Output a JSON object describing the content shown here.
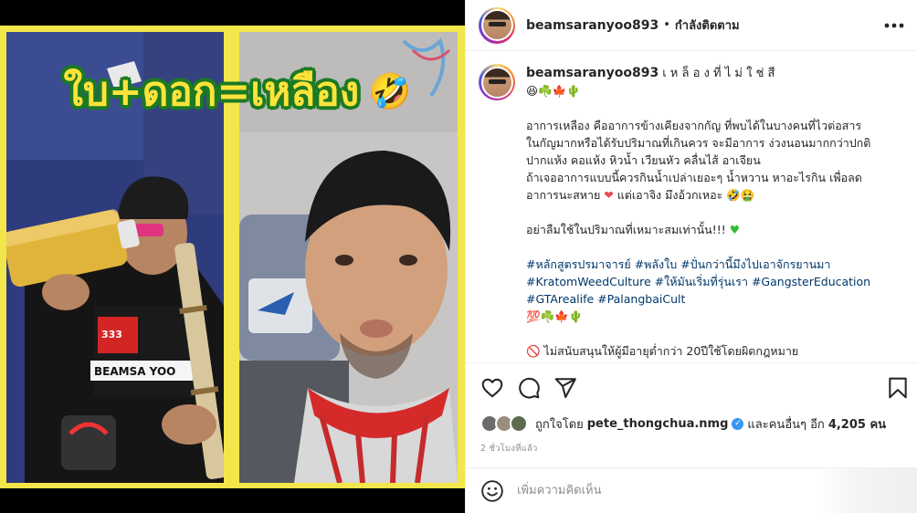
{
  "media": {
    "overlay_title": "ใบ+ดอก=เหลือง",
    "overlay_emoji": "🤣",
    "frame_color": "#f3e64a",
    "title_color": "#ffe33a",
    "title_outline_color": "#1b7a23"
  },
  "header": {
    "username": "beamsaranyoo893",
    "dot": "•",
    "following_label": "กำลังติดตาม",
    "more_icon": "more-horizontal-icon"
  },
  "caption": {
    "username": "beamsaranyoo893",
    "first_line": "เ ห ล็ อ ง ที่ ไ ม่ ใ ช่ สี",
    "emoji_line": "😆☘️🍁🌵",
    "paragraph1": [
      "อาการเหลือง คืออาการข้างเคียงจากกัญ ที่พบได้ในบางคนที่ไวต่อสาร",
      "ในกัญมากหรือได้รับปริมาณที่เกินควร จะมีอาการ ง่วงนอนมากกว่าปกติ",
      "ปากแห้ง คอแห้ง หิวน้ำ เวียนหัว คลื่นไส้ อาเจียน",
      "ถ้าเจออาการแบบนี้ควรกินน้ำเปล่าเยอะๆ น้ำหวาน หาอะไรกิน เพื่อลด"
    ],
    "paragraph1_last_prefix": "อาการนะสหาย ",
    "paragraph1_last_suffix": " แต่เอาจิง มึงอ้วกเหอะ 🤣🤮",
    "paragraph2": "อย่าลืมใช้ในปริมาณที่เหมาะสมเท่านั้น!!! ",
    "hashtags": [
      [
        "#หลักสูตรปรมาจารย์",
        "#พลังใบ",
        "#ปั่นกว่านี้มึงไปเอาจักรยานมา"
      ],
      [
        "#KratomWeedCulture",
        "#ให้มันเริ่มที่รุ่นเรา",
        "#GangsterEducation"
      ],
      [
        "#GTArealife",
        "#PalangbaiCult"
      ]
    ],
    "emoji_line2": "💯☘️🍁🌵",
    "warning_line": "🚫 ไม่สนับสนุนให้ผู้มีอายุต่ำกว่า 20ปีใช้โดยผิดกฎหมาย"
  },
  "actions": {
    "like_icon": "heart-outline-icon",
    "comment_icon": "comment-icon",
    "share_icon": "share-icon",
    "save_icon": "bookmark-icon"
  },
  "likes": {
    "liked_by_label": "ถูกใจโดย",
    "liked_by_user": "pete_thongchua.nmg",
    "verified_mark": "✓",
    "and_others_label": "และคนอื่นๆ อีก",
    "others_count": "4,205 คน"
  },
  "timestamp": "2 ชั่วโมงที่แล้ว",
  "comment": {
    "placeholder": "เพิ่มความคิดเห็น",
    "emoji_icon": "smiley-icon"
  }
}
